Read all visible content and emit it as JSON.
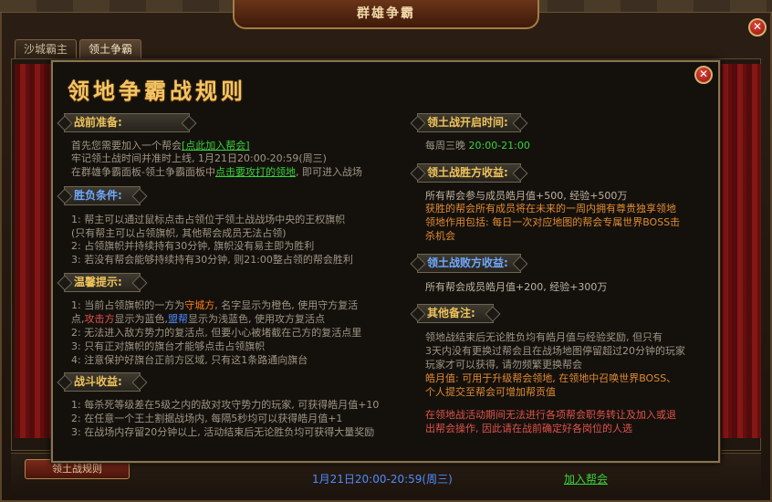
{
  "window": {
    "title": "群雄争霸",
    "tabs": [
      {
        "label": "沙城霸主",
        "active": false
      },
      {
        "label": "领土争霸",
        "active": true
      }
    ]
  },
  "bottom": {
    "rule_button": "领土战规则",
    "time": "1月21日20:00-20:59(周三)",
    "join_link": "加入帮会"
  },
  "popup": {
    "title": "领地争霸战规则",
    "close_icon": "close-icon",
    "left": {
      "prep": {
        "heading": "战前准备:",
        "line1_prefix": "首先您需要加入一个帮会",
        "line1_link": "[点此加入帮会]",
        "line2": "牢记领土战时间并准时上线, 1月21日20:00-20:59(周三)",
        "line3_prefix": "在群雄争霸面板-领土争霸面板中",
        "line3_link": "点击要攻打的领地",
        "line3_suffix": ", 即可进入战场"
      },
      "victory": {
        "heading": "胜负条件:",
        "lines": [
          "1: 帮主可以通过鼠标点击占领位于领土战战场中央的王权旗帜",
          "   (只有帮主可以占领旗帜, 其他帮会成员无法占领)",
          "2: 占领旗帜并持续持有30分钟, 旗帜没有易主即为胜利",
          "3: 若没有帮会能够持续持有30分钟, 则21:00整占领的帮会胜利"
        ]
      },
      "tips": {
        "heading": "温馨提示:",
        "line1_prefix": "1: 当前占领旗帜的一方为",
        "line1_highlight": "守城方",
        "line1_suffix": ", 名字显示为橙色, 使用守方复活",
        "line2_prefix": "点,",
        "line2_attack": "攻击方",
        "line2_mid": "显示为蓝色,",
        "line2_ally": "盟帮",
        "line2_suffix": "显示为浅蓝色, 使用攻方复活点",
        "line3": "2: 无法进入敌方势力的复活点, 但要小心被堵截在己方的复活点里",
        "line4": "3: 只有正对旗帜的旗台才能够点击占领旗帜",
        "line5": "4: 注意保护好旗台正前方区域, 只有这1条路通向旗台"
      },
      "reward": {
        "heading": "战斗收益:",
        "lines": [
          "1: 每杀死等级差在5级之内的敌对攻守势力的玩家, 可获得皓月值+10",
          "2: 在任意一个王土割据战场内, 每隔5秒均可以获得皓月值+1",
          "3: 在战场内存留20分钟以上, 活动结束后无论胜负均可获得大量奖励"
        ]
      }
    },
    "right": {
      "open_time": {
        "heading": "领土战开启时间:",
        "text_prefix": "每周三晚",
        "text_time": "20:00-21:00"
      },
      "win_reward": {
        "heading": "领土战胜方收益:",
        "line1": "所有帮会参与成员皓月值+500, 经验+500万",
        "line2": "获胜的帮会所有成员将在未来的一周内拥有尊贵独享领地",
        "line3": "领地作用包括: 每日一次对应地图的帮会专属世界BOSS击",
        "line4": "杀机会"
      },
      "lose_reward": {
        "heading": "领土战败方收益:",
        "line1": "所有帮会成员皓月值+200, 经验+300万"
      },
      "notes": {
        "heading": "其他备注:",
        "line1": "    领地战结束后无论胜负均有皓月值与经验奖励, 但只有",
        "line2": "3天内没有更换过帮会且在战场地图停留超过20分钟的玩家",
        "line3": "玩家才可以获得, 请勿频繁更换帮会",
        "line4": "皓月值: 可用于升级帮会领地, 在领地中召唤世界BOSS、",
        "line5": "个人提交至帮会可增加帮贡值",
        "line6": "在领地战活动期间无法进行各项帮会职务转让及加入或退",
        "line7": "出帮会操作, 因此请在战前确定好各岗位的人选"
      }
    }
  },
  "colors": {
    "heading_yellow": "#f0c35a",
    "heading_blue": "#6fa8ff",
    "link_green": "#37d23a",
    "highlight_orange": "#ff7a1a",
    "attacker_red": "#e2524a",
    "ally_blue": "#4f8bff",
    "title_gold": "#f3c566"
  }
}
